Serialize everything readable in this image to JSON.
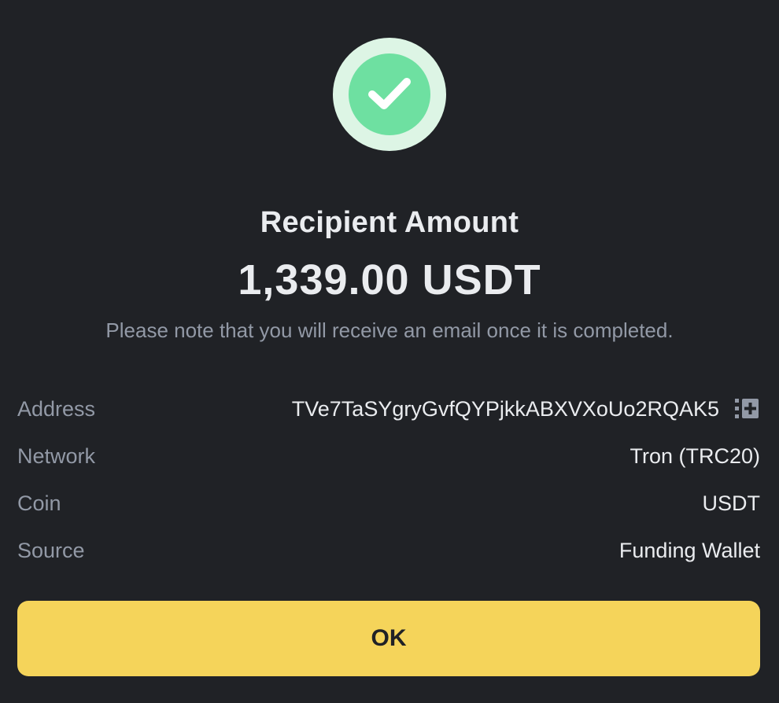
{
  "dialog": {
    "status_icon": "check-circle-icon",
    "title": "Recipient Amount",
    "amount": "1,339.00 USDT",
    "note": "Please note that you will receive an email once it is completed."
  },
  "details": [
    {
      "label": "Address",
      "value": "TVe7TaSYgryGvfQYPjkkABXVXoUo2RQAK5",
      "icon": "copy-icon"
    },
    {
      "label": "Network",
      "value": "Tron (TRC20)"
    },
    {
      "label": "Coin",
      "value": "USDT"
    },
    {
      "label": "Source",
      "value": "Funding Wallet"
    }
  ],
  "actions": {
    "ok_label": "OK"
  },
  "colors": {
    "background": "#202226",
    "primary_text": "#EAECEF",
    "secondary_text": "#9299A6",
    "success_outer": "#DDF5E5",
    "success_inner": "#6EE0A1",
    "button": "#F5D45A",
    "button_text": "#202226"
  }
}
